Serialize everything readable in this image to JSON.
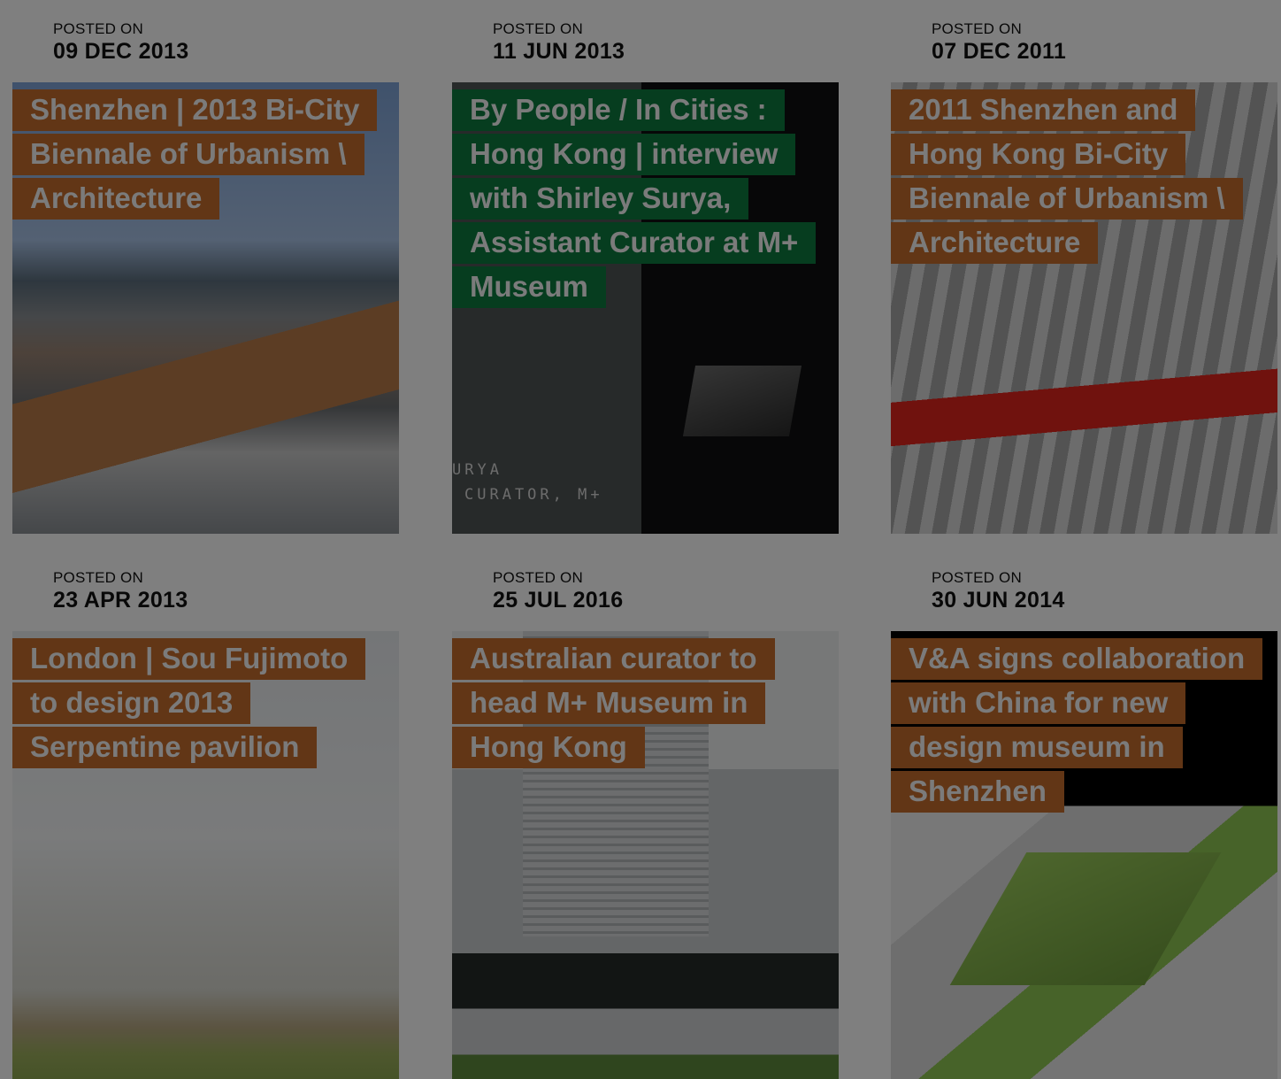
{
  "posted_label": "POSTED ON",
  "posts": [
    {
      "date": "09 DEC 2013",
      "title": "Shenzhen | 2013 Bi-City Biennale of Urbanism \\ Architecture"
    },
    {
      "date": "11 JUN 2013",
      "title": "By People / In Cities : Hong Kong | interview with Shirley Surya, Assistant Curator at M+ Museum",
      "image_caption_line1": "URYA",
      "image_caption_line2": "CURATOR, M+"
    },
    {
      "date": "07 DEC 2011",
      "title": "2011 Shenzhen and Hong Kong Bi-City Biennale of Urbanism \\ Architecture"
    },
    {
      "date": "23 APR 2013",
      "title": "London | Sou Fujimoto to design 2013 Serpentine pavilion"
    },
    {
      "date": "25 JUL 2016",
      "title": "Australian curator to head M+ Museum in Hong Kong"
    },
    {
      "date": "30 JUN 2014",
      "title": "V&A signs collaboration with China for new design museum in Shenzhen"
    }
  ],
  "colors": {
    "title_highlight": "#c56d2c",
    "title_highlight_alt": "#0d7a3f",
    "date_bar": "#ffffff",
    "modal_dim_overlay": "rgba(0,0,0,0.5)"
  }
}
